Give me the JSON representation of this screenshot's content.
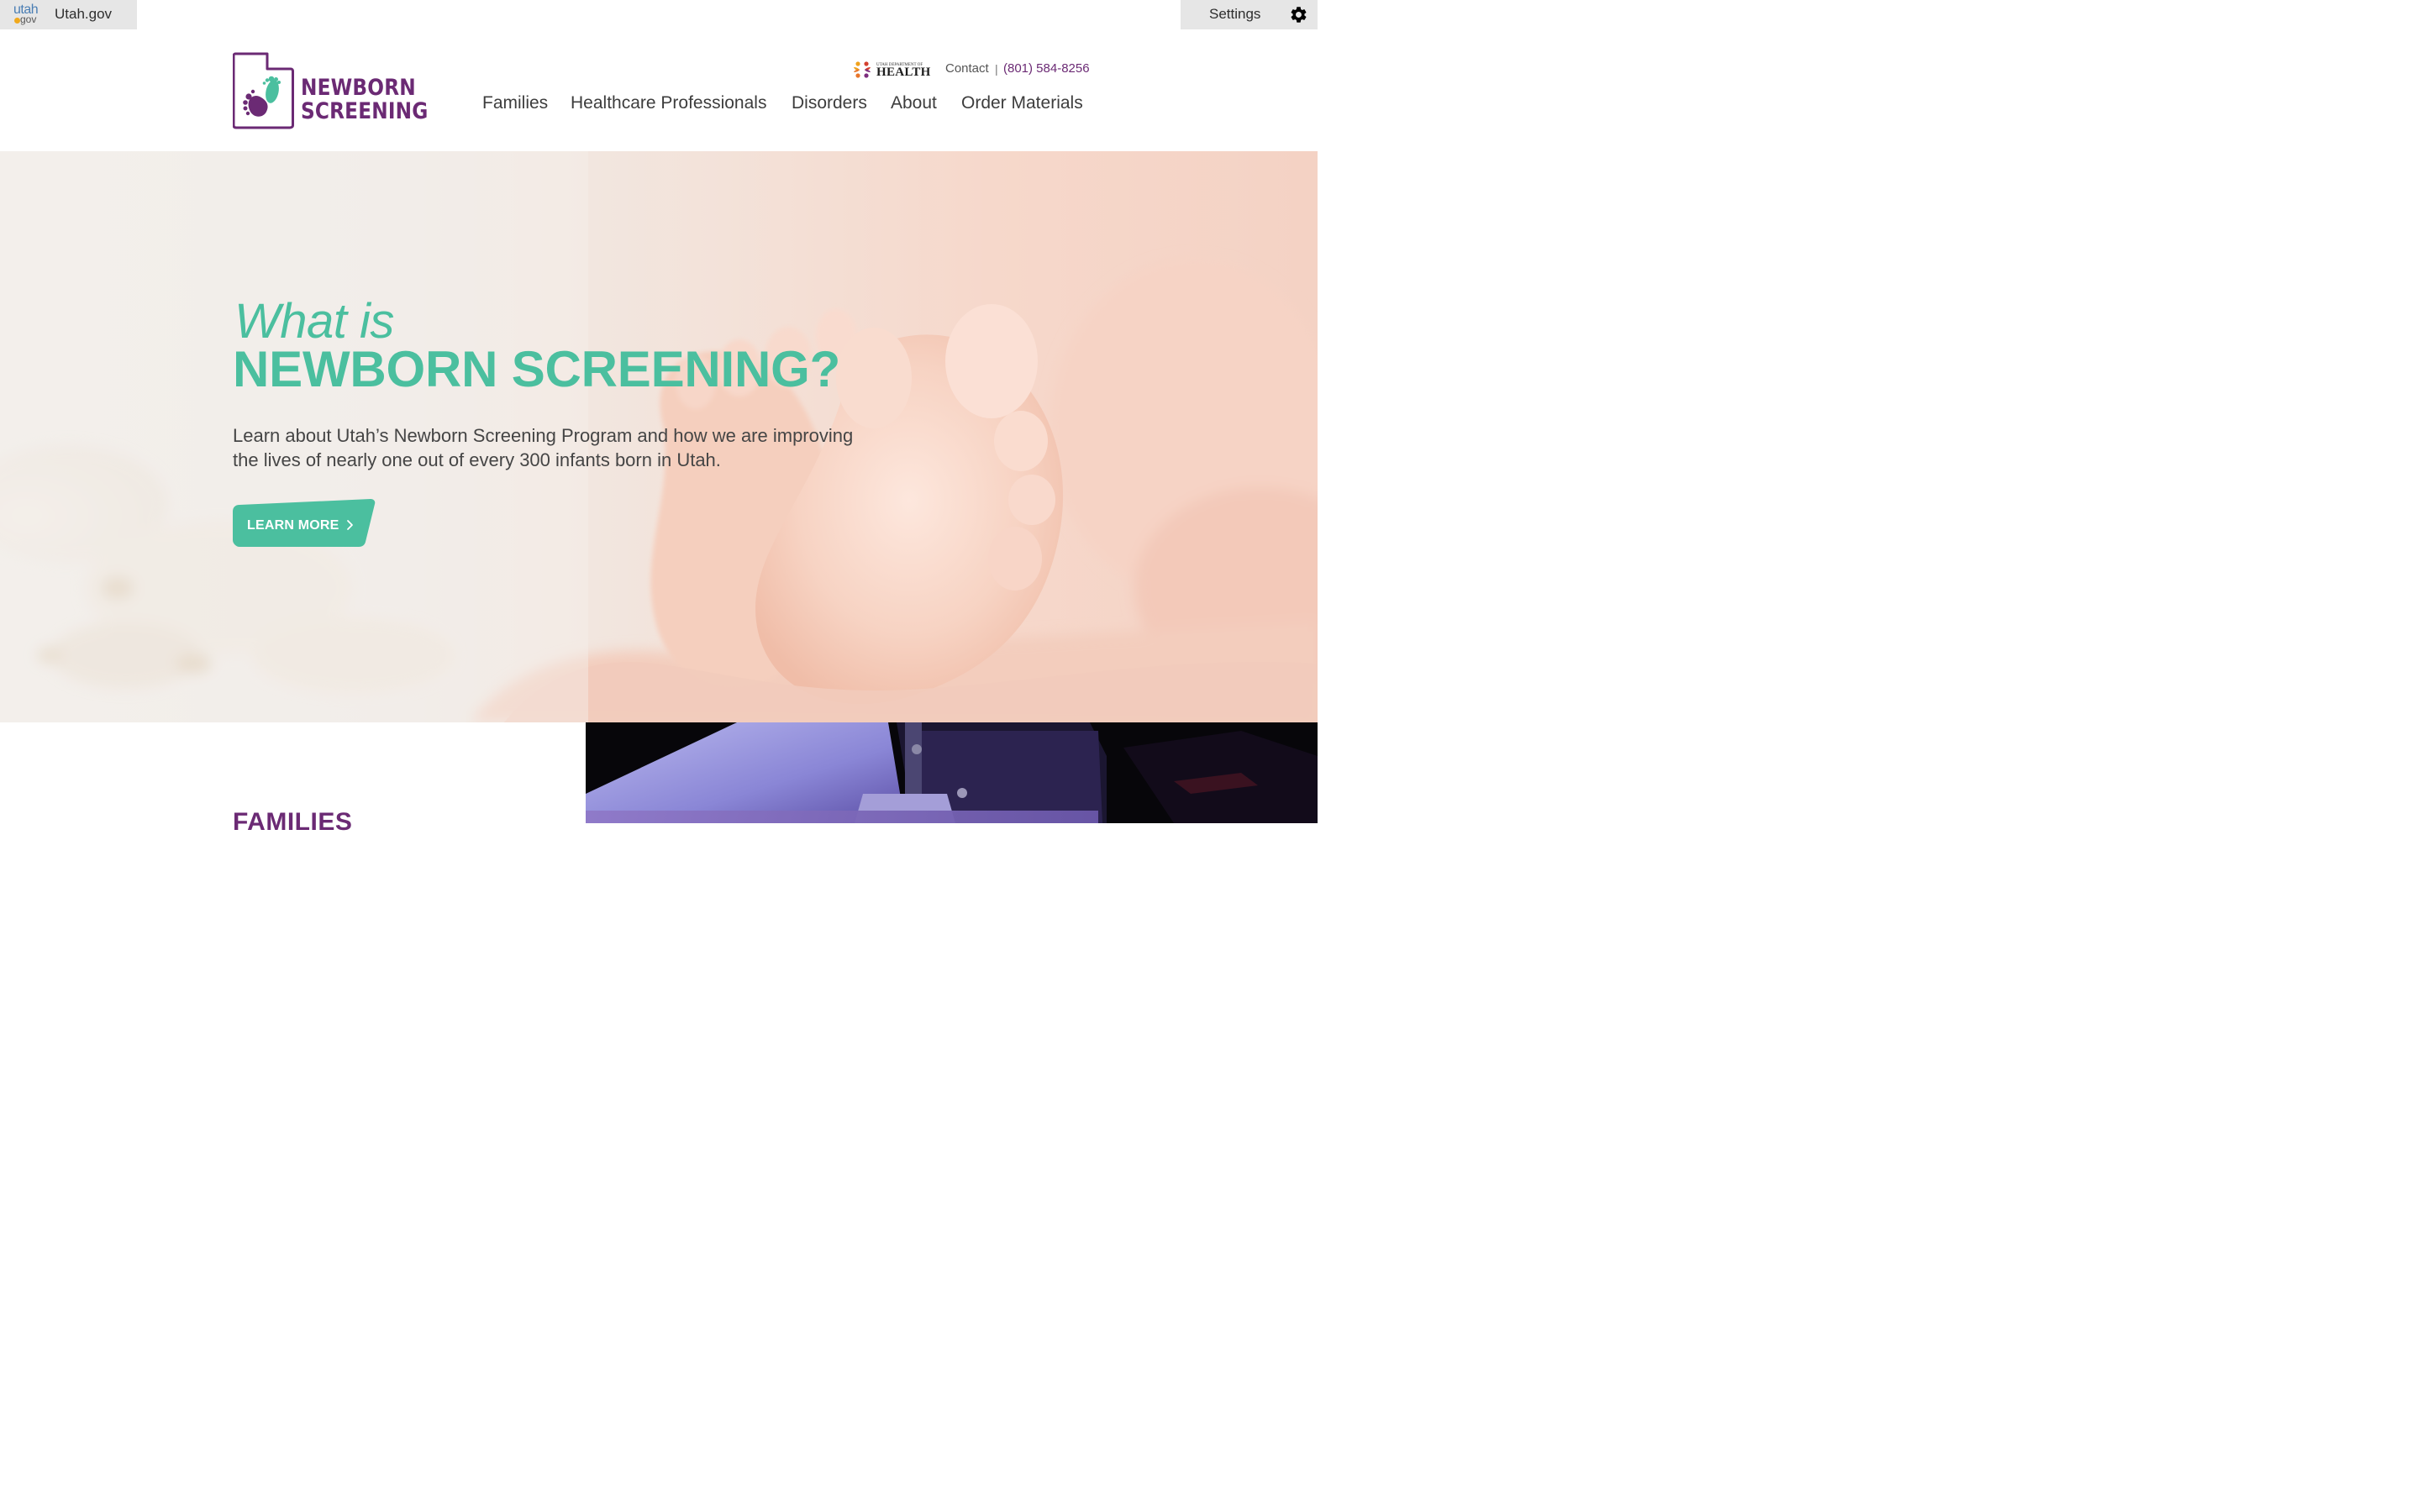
{
  "utah_bar": {
    "logo_top": "utah",
    "logo_bottom": "gov",
    "link_label": "Utah.gov",
    "settings_label": "Settings",
    "settings_icon": "gear-icon"
  },
  "header": {
    "logo_line1": "NEWBORN",
    "logo_line2": "SCREENING",
    "dept_small": "UTAH DEPARTMENT OF",
    "dept_big": "HEALTH",
    "contact_label": "Contact",
    "contact_separator": "|",
    "phone": "(801) 584-8256",
    "nav": [
      "Families",
      "Healthcare Professionals",
      "Disorders",
      "About",
      "Order Materials"
    ]
  },
  "hero": {
    "title_small": "What is",
    "title_big": "NEWBORN SCREENING?",
    "description": "Learn about Utah’s Newborn Screening Program and how we are improving the lives of nearly one out of every 300 infants born in Utah.",
    "cta_label": "LEARN MORE"
  },
  "sections": {
    "families_heading": "FAMILIES"
  },
  "colors": {
    "brand_purple": "#6b2a74",
    "brand_teal": "#4bbf9f",
    "top_bar_bg": "#e6e6e6",
    "text_dark": "#3d3d3d"
  }
}
